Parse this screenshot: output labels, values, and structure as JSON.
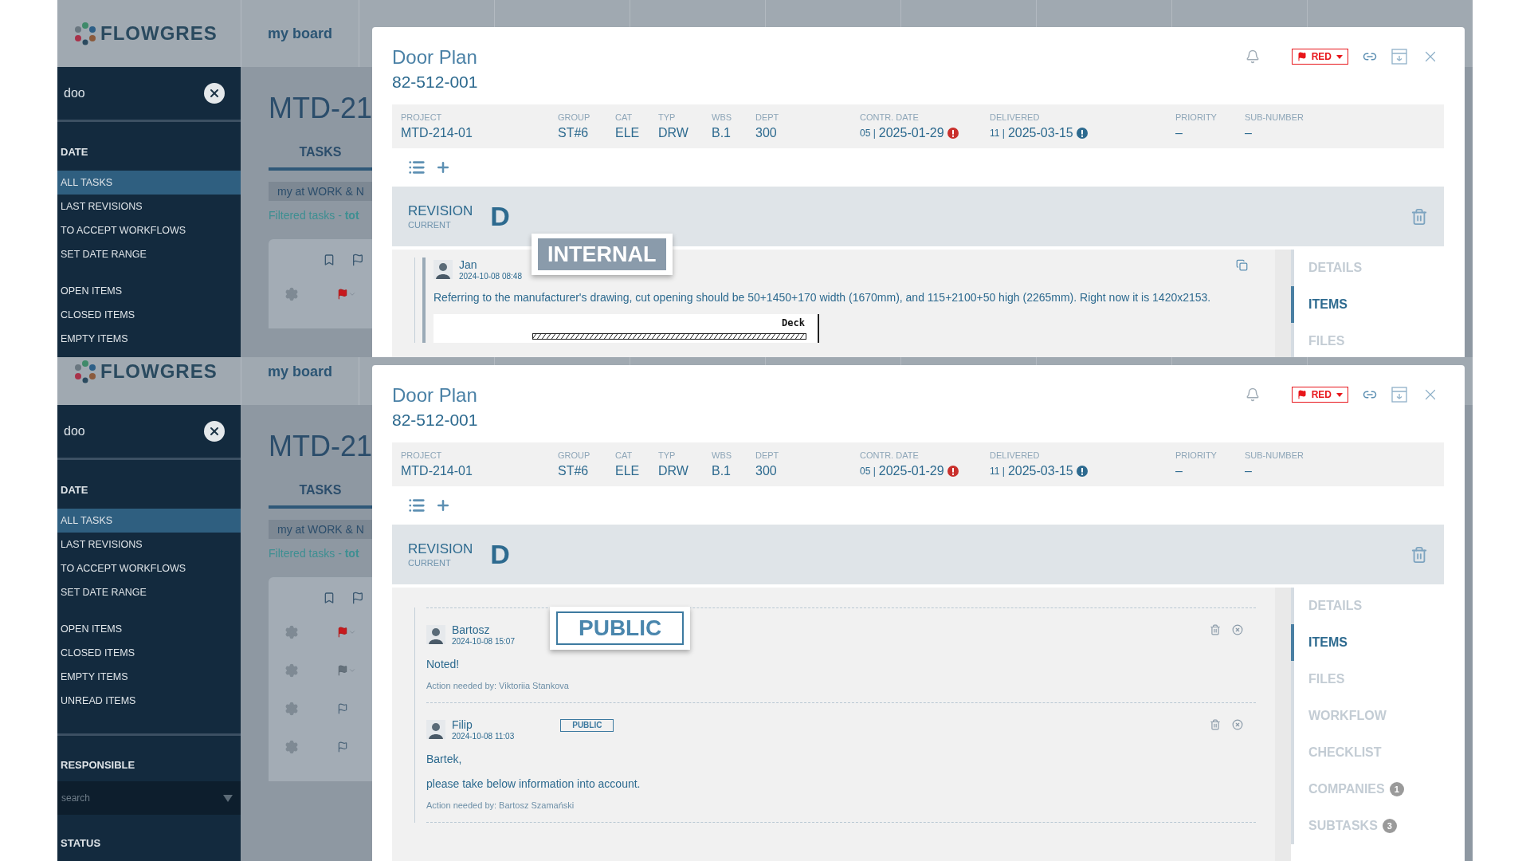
{
  "screens": [
    {
      "logo": "FLOWGRES",
      "board_tab": "my board",
      "sidebar": {
        "search_value": "doo",
        "sections": [
          {
            "kind": "filters",
            "title": "DATE",
            "items": [
              {
                "label": "ALL TASKS",
                "selected": true
              },
              {
                "label": "LAST REVISIONS",
                "selected": false
              },
              {
                "label": "TO ACCEPT WORKFLOWS",
                "selected": false
              },
              {
                "label": "SET DATE RANGE",
                "selected": false
              }
            ]
          },
          {
            "kind": "filters",
            "items": [
              {
                "label": "OPEN ITEMS",
                "selected": false
              },
              {
                "label": "CLOSED ITEMS",
                "selected": false
              },
              {
                "label": "EMPTY ITEMS",
                "selected": false
              }
            ]
          }
        ]
      },
      "board": {
        "title": "MTD-21",
        "tab": "TASKS",
        "chip": "my at WORK & N",
        "filter_note": "Filtered tasks - **tot**",
        "task_rows": [
          {
            "kind": "red"
          }
        ]
      },
      "modal": {
        "title": "Door Plan",
        "number": "82-512-001",
        "flag_label": "RED",
        "fields": [
          {
            "kind": "plain",
            "label": "PROJECT",
            "value": "MTD-214-01"
          },
          {
            "kind": "plain",
            "label": "GROUP",
            "value": "ST#6"
          },
          {
            "kind": "plain",
            "label": "CAT",
            "value": "ELE"
          },
          {
            "kind": "plain",
            "label": "TYP",
            "value": "DRW"
          },
          {
            "kind": "plain",
            "label": "WBS",
            "value": "B.1"
          },
          {
            "kind": "plain",
            "label": "DEPT",
            "value": "300"
          },
          {
            "kind": "warning",
            "label": "CONTR. DATE",
            "prefix": "05 |",
            "value": "2025-01-29"
          },
          {
            "kind": "info",
            "label": "DELIVERED",
            "prefix": "11 |",
            "value": "2025-03-15"
          },
          {
            "kind": "plain",
            "label": "PRIORITY",
            "value": "–"
          },
          {
            "kind": "plain",
            "label": "SUB-NUMBER",
            "value": "–"
          }
        ],
        "revision": {
          "label": "REVISION",
          "status": "CURRENT",
          "letter": "D"
        },
        "nav": [
          {
            "label": "DETAILS",
            "selected": false
          },
          {
            "label": "ITEMS",
            "selected": true
          },
          {
            "label": "FILES",
            "selected": false
          }
        ],
        "comments": [
          {
            "kind": "copyable",
            "author": "Jan",
            "time": "2024-10-08 08:48",
            "stamp": {
              "kind": "internal",
              "label": "INTERNAL",
              "enlarged": true
            },
            "paragraphs": [
              "Referring to the manufacturer's drawing, cut opening should be 50+1450+170 width (1670mm), and 115+2100+50 high (2265mm). Right now it is 1420x2153."
            ],
            "drawing_label": "Deck"
          }
        ]
      }
    },
    {
      "logo": "FLOWGRES",
      "board_tab": "my board",
      "sidebar": {
        "search_value": "doo",
        "sections": [
          {
            "kind": "filters",
            "title": "DATE",
            "items": [
              {
                "label": "ALL TASKS",
                "selected": true
              },
              {
                "label": "LAST REVISIONS",
                "selected": false
              },
              {
                "label": "TO ACCEPT WORKFLOWS",
                "selected": false
              },
              {
                "label": "SET DATE RANGE",
                "selected": false
              }
            ]
          },
          {
            "kind": "filters",
            "items": [
              {
                "label": "OPEN ITEMS",
                "selected": false
              },
              {
                "label": "CLOSED ITEMS",
                "selected": false
              },
              {
                "label": "EMPTY ITEMS",
                "selected": false
              },
              {
                "label": "UNREAD ITEMS",
                "selected": false
              }
            ]
          },
          {
            "kind": "select",
            "title": "RESPONSIBLE",
            "placeholder": "search"
          },
          {
            "kind": "heading",
            "title": "STATUS"
          }
        ]
      },
      "board": {
        "title": "MTD-21",
        "tab": "TASKS",
        "chip": "my at WORK & N",
        "filter_note": "Filtered tasks - **tot**",
        "task_rows": [
          {
            "kind": "red"
          },
          {
            "kind": "grey"
          },
          {
            "kind": "outline"
          },
          {
            "kind": "outline"
          }
        ]
      },
      "modal": {
        "title": "Door Plan",
        "number": "82-512-001",
        "flag_label": "RED",
        "fields": [
          {
            "kind": "plain",
            "label": "PROJECT",
            "value": "MTD-214-01"
          },
          {
            "kind": "plain",
            "label": "GROUP",
            "value": "ST#6"
          },
          {
            "kind": "plain",
            "label": "CAT",
            "value": "ELE"
          },
          {
            "kind": "plain",
            "label": "TYP",
            "value": "DRW"
          },
          {
            "kind": "plain",
            "label": "WBS",
            "value": "B.1"
          },
          {
            "kind": "plain",
            "label": "DEPT",
            "value": "300"
          },
          {
            "kind": "warning",
            "label": "CONTR. DATE",
            "prefix": "05 |",
            "value": "2025-01-29"
          },
          {
            "kind": "info",
            "label": "DELIVERED",
            "prefix": "11 |",
            "value": "2025-03-15"
          },
          {
            "kind": "plain",
            "label": "PRIORITY",
            "value": "–"
          },
          {
            "kind": "plain",
            "label": "SUB-NUMBER",
            "value": "–"
          }
        ],
        "revision": {
          "label": "REVISION",
          "status": "CURRENT",
          "letter": "D"
        },
        "nav": [
          {
            "label": "DETAILS",
            "selected": false
          },
          {
            "label": "ITEMS",
            "selected": true
          },
          {
            "label": "FILES",
            "selected": false
          },
          {
            "label": "WORKFLOW",
            "selected": false
          },
          {
            "label": "CHECKLIST",
            "selected": false
          },
          {
            "label": "COMPANIES",
            "count": "1",
            "selected": false
          },
          {
            "label": "SUBTASKS",
            "count": "3",
            "selected": false
          }
        ],
        "comments": [
          {
            "kind": "deletable",
            "author": "Bartosz",
            "time": "2024-10-08 15:07",
            "stamp": {
              "kind": "public",
              "label": "PUBLIC",
              "enlarged": true
            },
            "paragraphs": [
              "Noted!"
            ],
            "action": "Action needed by: Viktoriia Stankova"
          },
          {
            "kind": "deletable",
            "author": "Filip",
            "time": "2024-10-08 11:03",
            "stamp": {
              "kind": "public",
              "label": "PUBLIC",
              "enlarged": false
            },
            "paragraphs": [
              "Bartek,",
              "please take below information into account."
            ],
            "action": "Action needed by: Bartosz Szamański"
          }
        ]
      }
    }
  ]
}
